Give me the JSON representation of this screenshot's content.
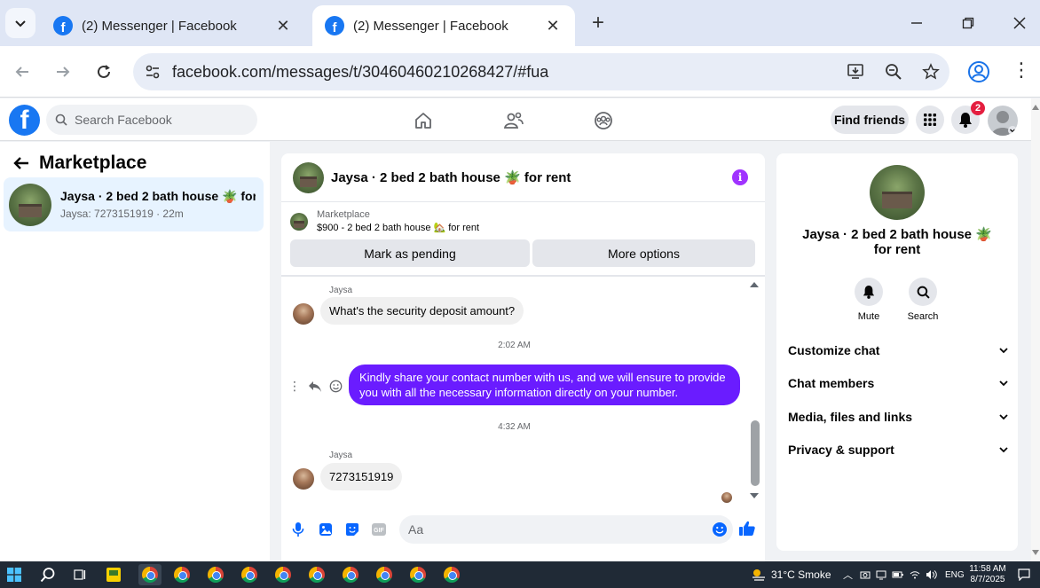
{
  "browser": {
    "tabs": [
      {
        "title": "(2) Messenger | Facebook",
        "active": false
      },
      {
        "title": "(2) Messenger | Facebook",
        "active": true
      }
    ],
    "url": "facebook.com/messages/t/30460460210268427/#fua"
  },
  "fb_header": {
    "search_placeholder": "Search Facebook",
    "find_friends_label": "Find friends",
    "notification_count": "2"
  },
  "left_panel": {
    "title": "Marketplace",
    "conversations": [
      {
        "name": "Jaysa · 2 bed 2 bath house 🪴 for r...",
        "subtitle": "Jaysa: 7273151919 · 22m"
      }
    ]
  },
  "chat": {
    "header_name": "Jaysa · 2 bed 2 bath house 🪴 for rent",
    "marketplace_label": "Marketplace",
    "listing": "$900 - 2 bed 2 bath house 🏡 for rent",
    "mark_pending_label": "Mark as pending",
    "more_options_label": "More options",
    "messages": [
      {
        "sender": "Jaysa",
        "text": "What's the security deposit amount?"
      },
      {
        "timestamp": "2:02 AM"
      },
      {
        "outgoing": true,
        "text": "Kindly share your contact number with us, and we will ensure to provide you with all the necessary information directly on your number."
      },
      {
        "timestamp": "4:32 AM"
      },
      {
        "sender": "Jaysa",
        "text": "7273151919"
      }
    ],
    "input_placeholder": "Aa",
    "gif_label": "GIF"
  },
  "right_panel": {
    "name": "Jaysa · 2 bed 2 bath house 🪴 for rent",
    "actions": [
      {
        "label": "Mute"
      },
      {
        "label": "Search"
      }
    ],
    "sections": [
      {
        "label": "Customize chat"
      },
      {
        "label": "Chat members"
      },
      {
        "label": "Media, files and links"
      },
      {
        "label": "Privacy & support"
      }
    ]
  },
  "taskbar": {
    "weather": "31°C Smoke",
    "language": "ENG",
    "time": "11:58 AM",
    "date": "8/7/2025"
  },
  "colors": {
    "fb_blue": "#1877f2",
    "outgoing_bubble": "#6a1cff",
    "info_purple": "#a033ff",
    "notification_red": "#e41e3f"
  }
}
